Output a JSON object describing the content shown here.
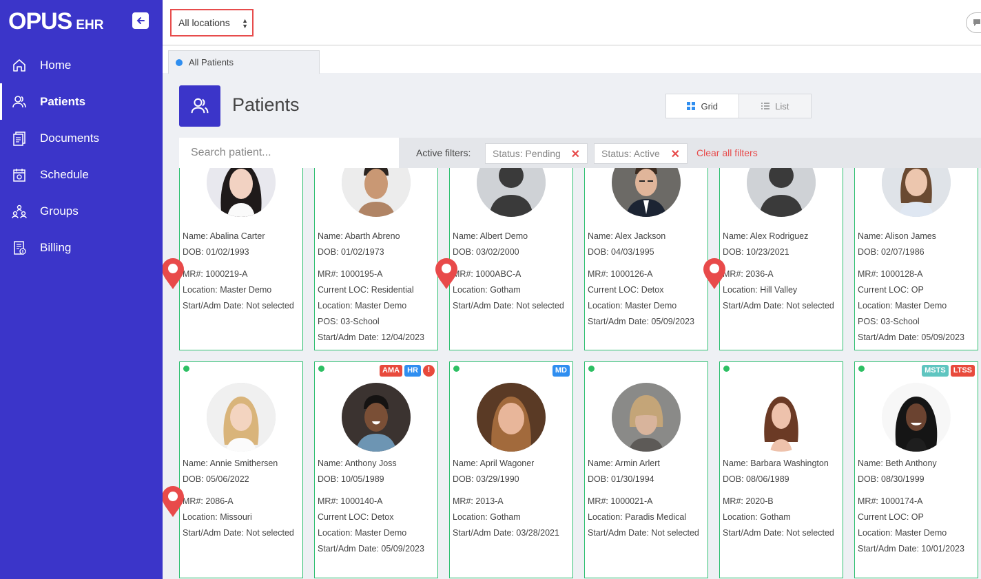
{
  "app": {
    "logo": "OPUS",
    "logo_suffix": "EHR"
  },
  "sidebar": {
    "items": [
      {
        "label": "Home",
        "icon": "home-icon",
        "active": false
      },
      {
        "label": "Patients",
        "icon": "users-icon",
        "active": true
      },
      {
        "label": "Documents",
        "icon": "documents-icon",
        "active": false
      },
      {
        "label": "Schedule",
        "icon": "calendar-icon",
        "active": false
      },
      {
        "label": "Groups",
        "icon": "groups-icon",
        "active": false
      },
      {
        "label": "Billing",
        "icon": "billing-icon",
        "active": false
      }
    ]
  },
  "topbar": {
    "location_select": "All locations"
  },
  "tabs": [
    {
      "label": "All Patients"
    }
  ],
  "page": {
    "title": "Patients"
  },
  "view_toggle": {
    "grid_label": "Grid",
    "list_label": "List"
  },
  "filters": {
    "search_placeholder": "Search patient...",
    "active_label": "Active filters:",
    "chips": [
      "Status: Pending",
      "Status: Active"
    ],
    "clear_label": "Clear all filters"
  },
  "colors": {
    "sidebar": "#3b35c9",
    "accent_red": "#e74c4c",
    "card_border": "#2fbf71",
    "status_green": "#2dbf63"
  },
  "patients": [
    {
      "name": "Name: Abalina Carter",
      "dob": "DOB: 01/02/1993",
      "lines": [
        "MR#: 1000219-A",
        "Location: Master Demo",
        "Start/Adm Date: Not selected"
      ]
    },
    {
      "name": "Name: Abarth Abreno",
      "dob": "DOB: 01/02/1973",
      "lines": [
        "MR#: 1000195-A",
        "Current LOC: Residential",
        "Location: Master Demo",
        "POS: 03-School",
        "Start/Adm Date: 12/04/2023"
      ]
    },
    {
      "name": "Name: Albert Demo",
      "dob": "DOB: 03/02/2000",
      "lines": [
        "MR#: 1000ABC-A",
        "Location: Gotham",
        "Start/Adm Date: Not selected"
      ]
    },
    {
      "name": "Name: Alex Jackson",
      "dob": "DOB: 04/03/1995",
      "lines": [
        "MR#: 1000126-A",
        "Current LOC: Detox",
        "Location: Master Demo",
        "Start/Adm Date: 05/09/2023"
      ]
    },
    {
      "name": "Name: Alex Rodriguez",
      "dob": "DOB: 10/23/2021",
      "lines": [
        "MR#: 2036-A",
        "Location: Hill Valley",
        "Start/Adm Date: Not selected"
      ]
    },
    {
      "name": "Name: Alison James",
      "dob": "DOB: 02/07/1986",
      "lines": [
        "MR#: 1000128-A",
        "Current LOC: OP",
        "Location: Master Demo",
        "POS: 03-School",
        "Start/Adm Date: 05/09/2023"
      ]
    },
    {
      "name": "Name: Annie Smithersen",
      "dob": "DOB: 05/06/2022",
      "lines": [
        "MR#: 2086-A",
        "Location: Missouri",
        "Start/Adm Date: Not selected"
      ],
      "badges": []
    },
    {
      "name": "Name: Anthony Joss",
      "dob": "DOB: 10/05/1989",
      "lines": [
        "MR#: 1000140-A",
        "Current LOC: Detox",
        "Location: Master Demo",
        "Start/Adm Date: 05/09/2023"
      ],
      "badges": [
        "AMA",
        "HR",
        "!"
      ]
    },
    {
      "name": "Name: April Wagoner",
      "dob": "DOB: 03/29/1990",
      "lines": [
        "MR#: 2013-A",
        "Location: Gotham",
        "Start/Adm Date: 03/28/2021"
      ],
      "badges": [
        "MD"
      ]
    },
    {
      "name": "Name: Armin Arlert",
      "dob": "DOB: 01/30/1994",
      "lines": [
        "MR#: 1000021-A",
        "Location: Paradis Medical",
        "Start/Adm Date: Not selected"
      ],
      "badges": []
    },
    {
      "name": "Name: Barbara Washington",
      "dob": "DOB: 08/06/1989",
      "lines": [
        "MR#: 2020-B",
        "Location: Gotham",
        "Start/Adm Date: Not selected"
      ],
      "badges": []
    },
    {
      "name": "Name: Beth Anthony",
      "dob": "DOB: 08/30/1999",
      "lines": [
        "MR#: 1000174-A",
        "Current LOC: OP",
        "Location: Master Demo",
        "Start/Adm Date: 10/01/2023"
      ],
      "badges": [
        "MSTS",
        "LTSS"
      ]
    }
  ]
}
